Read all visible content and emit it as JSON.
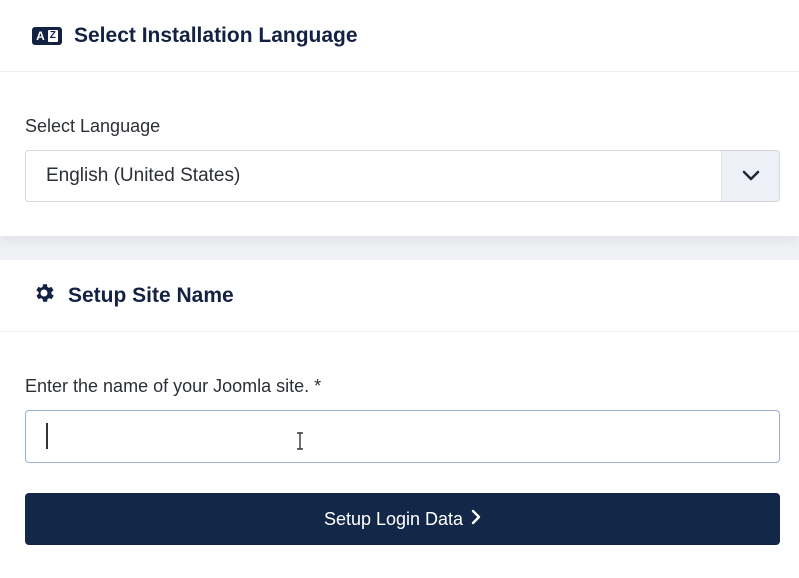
{
  "language_section": {
    "title": "Select Installation Language",
    "icon": "language-icon",
    "field_label": "Select Language",
    "selected_value": "English (United States)"
  },
  "site_section": {
    "title": "Setup Site Name",
    "icon": "gear-icon",
    "field_label": "Enter the name of your Joomla site. *",
    "input_value": "",
    "button_label": "Setup Login Data"
  },
  "colors": {
    "primary": "#132849",
    "heading": "#132243",
    "background": "#eef0f4"
  }
}
